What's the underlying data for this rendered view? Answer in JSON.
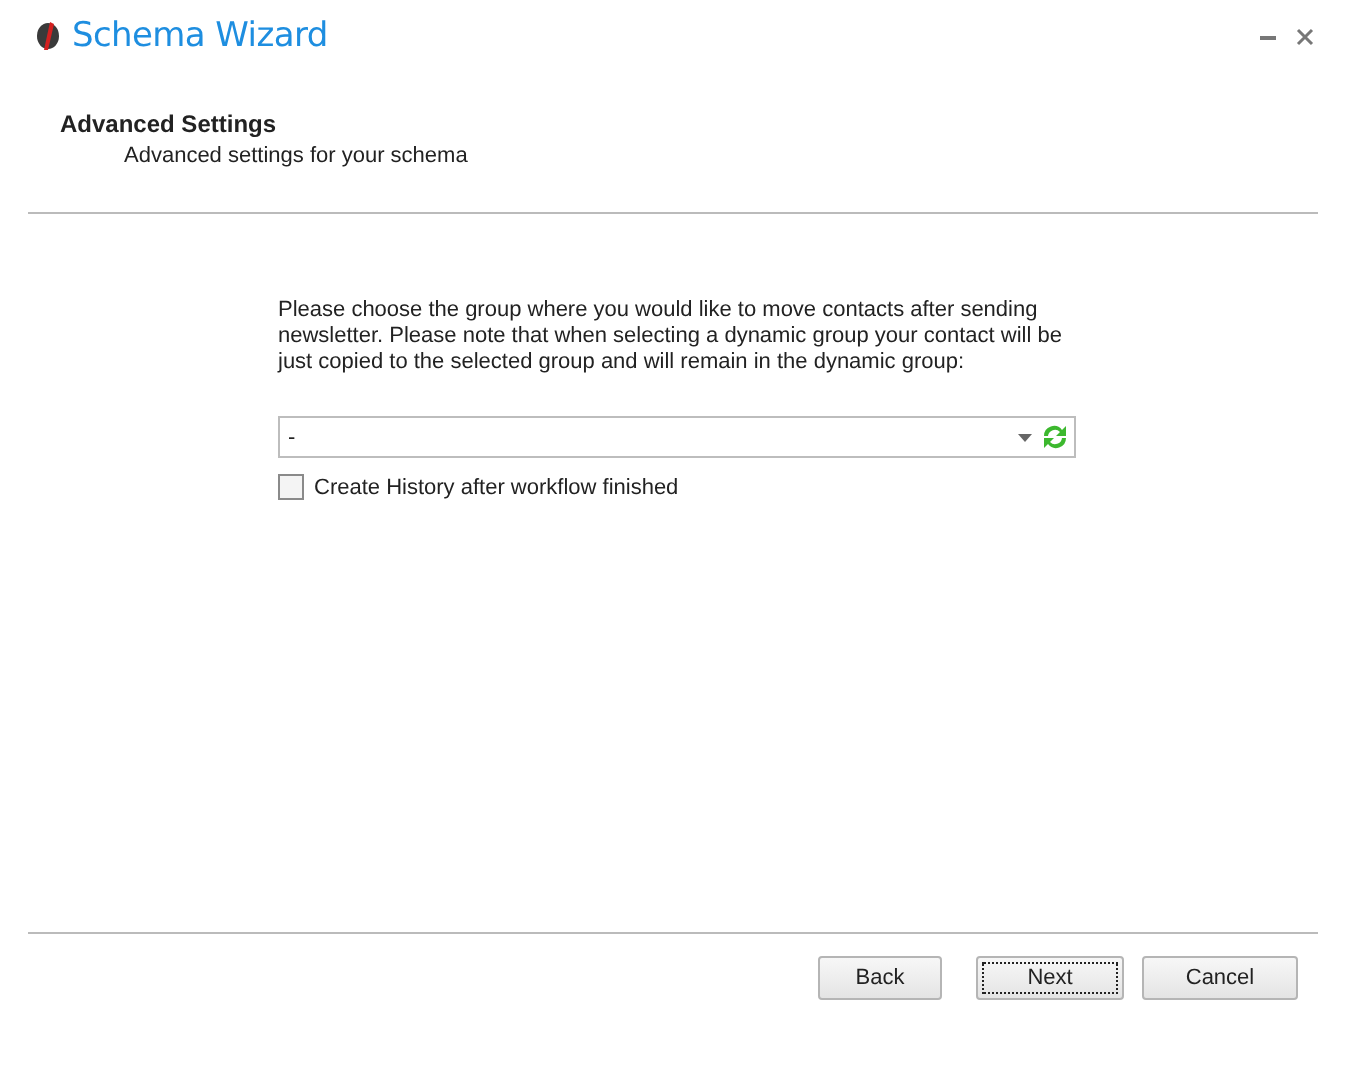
{
  "window": {
    "title": "Schema Wizard"
  },
  "header": {
    "title": "Advanced Settings",
    "subtitle": "Advanced settings for your schema"
  },
  "description": "Please choose the group where you would like to move contacts after sending newsletter. Please note that when selecting a dynamic group your contact will be just copied to the selected group and will remain in the dynamic group:",
  "group_select": {
    "value": "-"
  },
  "history_checkbox": {
    "label": "Create History after workflow finished",
    "checked": false
  },
  "buttons": [
    {
      "label": "Back",
      "focused": false
    },
    {
      "label": "Next",
      "focused": true
    },
    {
      "label": "Cancel",
      "focused": false
    }
  ]
}
